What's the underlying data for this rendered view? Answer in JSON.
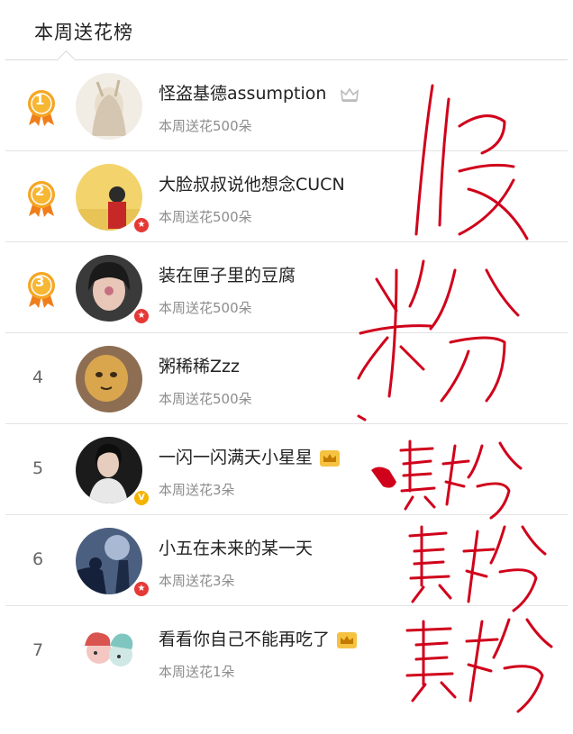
{
  "header": {
    "title": "本周送花榜"
  },
  "rows": [
    {
      "rank": "1",
      "name": "怪盗基德assumption",
      "sub": "本周送花500朵",
      "badge": "crown-outline-icon"
    },
    {
      "rank": "2",
      "name": "大脸叔叔说他想念CUCN",
      "sub": "本周送花500朵",
      "badge": ""
    },
    {
      "rank": "3",
      "name": "装在匣子里的豆腐",
      "sub": "本周送花500朵",
      "badge": ""
    },
    {
      "rank": "4",
      "name": "粥稀稀Zzz",
      "sub": "本周送花500朵",
      "badge": ""
    },
    {
      "rank": "5",
      "name": "一闪一闪满天小星星",
      "sub": "本周送花3朵",
      "badge": "crown-gold-icon"
    },
    {
      "rank": "6",
      "name": "小五在未来的某一天",
      "sub": "本周送花3朵",
      "badge": ""
    },
    {
      "rank": "7",
      "name": "看看你自己不能再吃了",
      "sub": "本周送花1朵",
      "badge": "crown-gold-icon"
    }
  ],
  "annotations": [
    "假",
    "粉",
    "真粉",
    "真粉",
    "真粉"
  ],
  "colors": {
    "medal_gold": "#f5a623",
    "medal_ribbon": "#f07e1b",
    "ink": "#d0021b",
    "divider": "#e3e3e3",
    "sub_text": "#8c8c8c"
  }
}
